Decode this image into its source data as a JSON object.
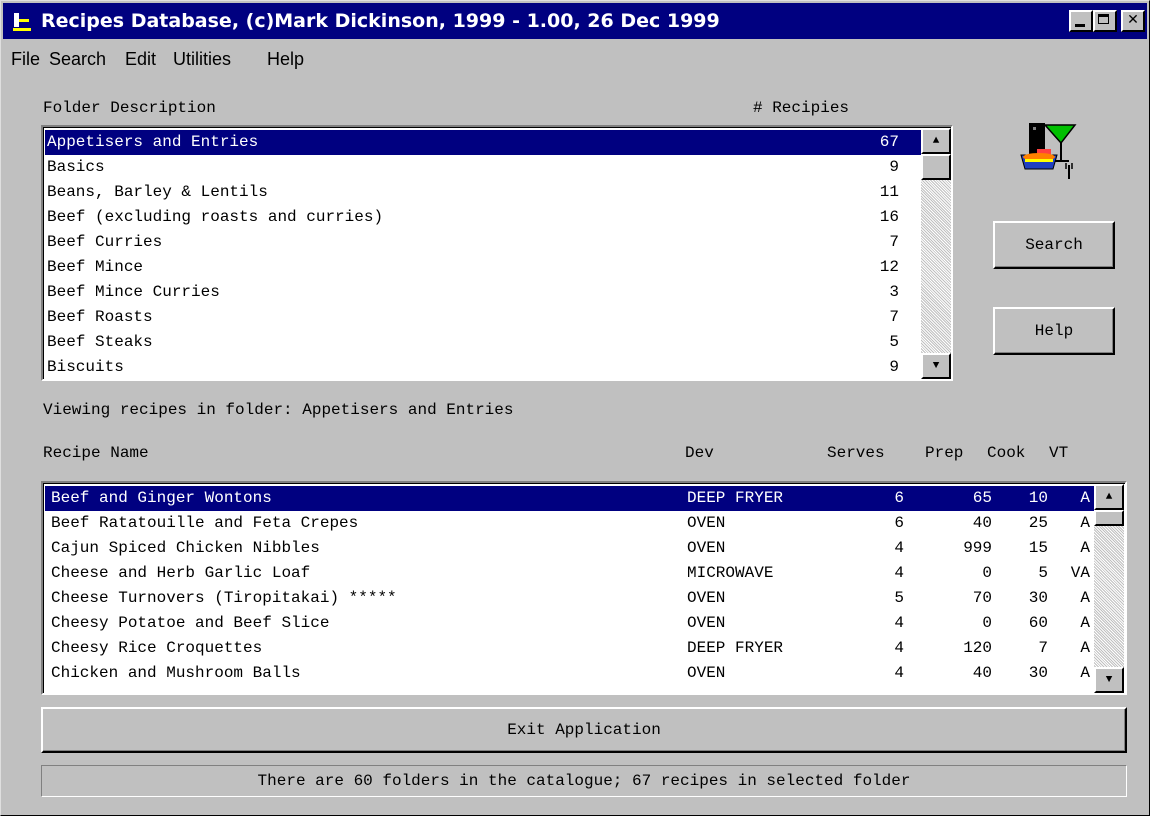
{
  "window": {
    "title": "Recipes Database, (c)Mark Dickinson, 1999 - 1.00, 26 Dec 1999",
    "controls": [
      "minimize-icon",
      "maximize-icon",
      "close-icon"
    ],
    "close_glyph": "✕"
  },
  "menu": [
    "File",
    "Search",
    "Edit",
    "Utilities",
    "Help"
  ],
  "folders": {
    "header_description": "Folder Description",
    "header_count": "# Recipies",
    "rows": [
      {
        "name": "Appetisers and Entries",
        "count": "67"
      },
      {
        "name": "Basics",
        "count": "9"
      },
      {
        "name": "Beans, Barley & Lentils",
        "count": "11"
      },
      {
        "name": "Beef (excluding roasts and curries)",
        "count": "16"
      },
      {
        "name": "Beef Curries",
        "count": "7"
      },
      {
        "name": "Beef Mince",
        "count": "12"
      },
      {
        "name": "Beef Mince Curries",
        "count": "3"
      },
      {
        "name": "Beef Roasts",
        "count": "7"
      },
      {
        "name": "Beef Steaks",
        "count": "5"
      },
      {
        "name": "Biscuits",
        "count": "9"
      }
    ],
    "selected_index": 0
  },
  "buttons": {
    "search": "Search",
    "help": "Help",
    "exit": "Exit Application"
  },
  "viewing_label": "Viewing recipes in folder: Appetisers and Entries",
  "recipes": {
    "headers": {
      "name": "Recipe Name",
      "dev": "Dev",
      "serves": "Serves",
      "prep": "Prep",
      "cook": "Cook",
      "vt": "VT"
    },
    "rows": [
      {
        "name": "Beef and Ginger Wontons",
        "dev": "DEEP FRYER",
        "serves": "6",
        "prep": "65",
        "cook": "10",
        "vt": "A"
      },
      {
        "name": "Beef Ratatouille and Feta Crepes",
        "dev": "OVEN",
        "serves": "6",
        "prep": "40",
        "cook": "25",
        "vt": "A"
      },
      {
        "name": "Cajun Spiced Chicken Nibbles",
        "dev": "OVEN",
        "serves": "4",
        "prep": "999",
        "cook": "15",
        "vt": "A"
      },
      {
        "name": "Cheese and Herb Garlic Loaf",
        "dev": "MICROWAVE",
        "serves": "4",
        "prep": "0",
        "cook": "5",
        "vt": "VA"
      },
      {
        "name": "Cheese Turnovers (Tiropitakai) *****",
        "dev": "OVEN",
        "serves": "5",
        "prep": "70",
        "cook": "30",
        "vt": "A"
      },
      {
        "name": "Cheesy Potatoe and Beef Slice",
        "dev": "OVEN",
        "serves": "4",
        "prep": "0",
        "cook": "60",
        "vt": "A"
      },
      {
        "name": "Cheesy Rice Croquettes",
        "dev": "DEEP FRYER",
        "serves": "4",
        "prep": "120",
        "cook": "7",
        "vt": "A"
      },
      {
        "name": "Chicken and Mushroom Balls",
        "dev": "OVEN",
        "serves": "4",
        "prep": "40",
        "cook": "30",
        "vt": "A"
      }
    ],
    "selected_index": 0
  },
  "status": "There are 60 folders in the catalogue; 67 recipes in selected folder",
  "colors": {
    "selection": "#000080",
    "titlebar": "#000080",
    "face": "#c0c0c0"
  }
}
